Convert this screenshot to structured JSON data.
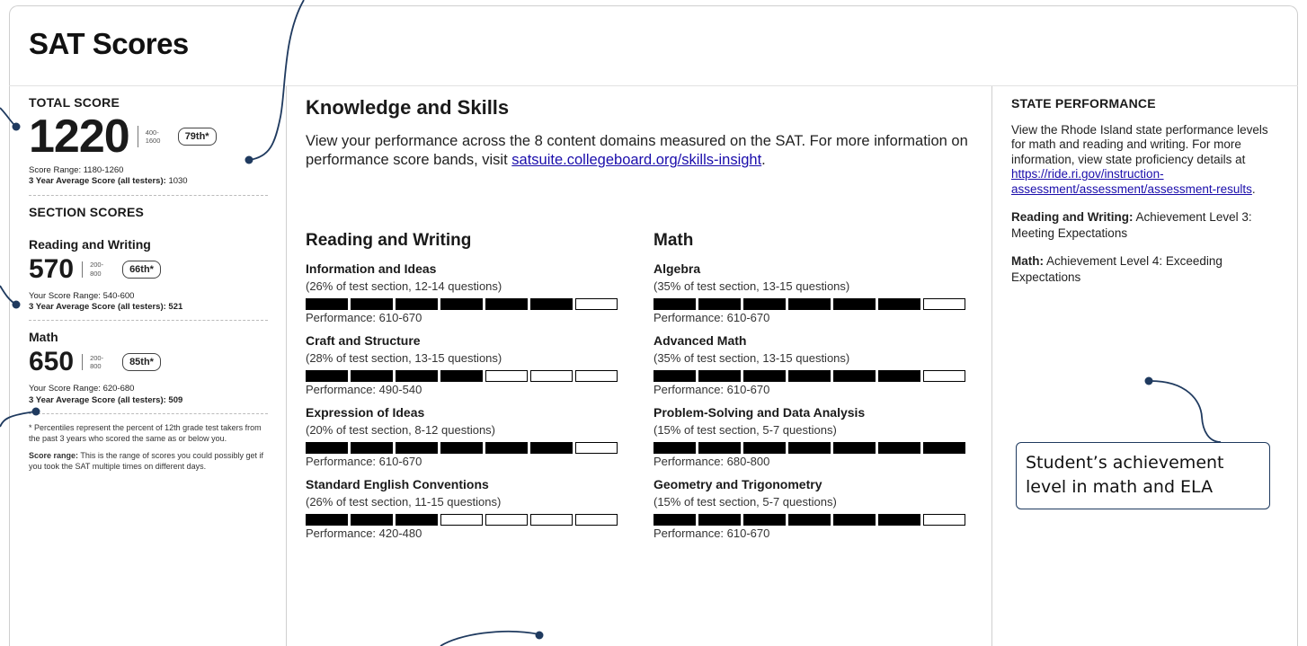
{
  "title": "SAT Scores",
  "total": {
    "label": "TOTAL SCORE",
    "score": "1220",
    "range_min": "400-",
    "range_max": "1600",
    "percentile": "79th*",
    "score_range": "Score Range: 1180-1260",
    "avg_label": "3 Year Average Score (all testers):",
    "avg_value": "1030"
  },
  "section_scores": {
    "label": "SECTION SCORES",
    "reading_writing": {
      "name": "Reading and Writing",
      "score": "570",
      "range_min": "200-",
      "range_max": "800",
      "percentile": "66th*",
      "score_range": "Your Score Range: 540-600",
      "avg": "3 Year Average Score (all testers): 521"
    },
    "math": {
      "name": "Math",
      "score": "650",
      "range_min": "200-",
      "range_max": "800",
      "percentile": "85th*",
      "score_range": "Your Score Range: 620-680",
      "avg": "3 Year Average Score (all testers): 509"
    }
  },
  "notes": {
    "percentile": "* Percentiles represent the percent of 12th grade test takers from the past 3 years who scored the same as or below you.",
    "range_label": "Score range:",
    "range_text": "This is the range of scores you could possibly get if you took the SAT multiple times on different days."
  },
  "knowledge": {
    "title": "Knowledge and Skills",
    "intro": "View your performance across the 8 content domains measured on the SAT. For more information on performance score bands, visit",
    "link": "satsuite.collegeboard.org/skills-insight",
    "period": "."
  },
  "domains": {
    "reading_writing": {
      "title": "Reading and Writing",
      "skills": [
        {
          "name": "Information and Ideas",
          "desc": "(26% of test section, 12-14 questions)",
          "filled": 6,
          "total": 7,
          "perf": "Performance: 610-670"
        },
        {
          "name": "Craft and Structure",
          "desc": "(28% of test section, 13-15 questions)",
          "filled": 4,
          "total": 7,
          "perf": "Performance: 490-540"
        },
        {
          "name": "Expression of Ideas",
          "desc": "(20% of test section, 8-12 questions)",
          "filled": 6,
          "total": 7,
          "perf": "Performance: 610-670"
        },
        {
          "name": "Standard English Conventions",
          "desc": "(26% of test section, 11-15 questions)",
          "filled": 3,
          "total": 7,
          "perf": "Performance: 420-480"
        }
      ]
    },
    "math": {
      "title": "Math",
      "skills": [
        {
          "name": "Algebra",
          "desc": "(35% of test section, 13-15 questions)",
          "filled": 6,
          "total": 7,
          "perf": "Performance: 610-670"
        },
        {
          "name": "Advanced Math",
          "desc": "(35% of test section, 13-15 questions)",
          "filled": 6,
          "total": 7,
          "perf": "Performance: 610-670"
        },
        {
          "name": "Problem-Solving and Data Analysis",
          "desc": "(15% of test section, 5-7 questions)",
          "filled": 7,
          "total": 7,
          "perf": "Performance: 680-800"
        },
        {
          "name": "Geometry and Trigonometry",
          "desc": "(15% of test section, 5-7 questions)",
          "filled": 6,
          "total": 7,
          "perf": "Performance: 610-670"
        }
      ]
    }
  },
  "state": {
    "title": "STATE PERFORMANCE",
    "desc": "View the Rhode Island state performance levels for math and reading and writing. For more information, view state proficiency details at",
    "link": "https://ride.ri.gov/instruction-assessment/assessment/assessment-results",
    "period": ".",
    "rw_label": "Reading and Writing:",
    "rw_text": "Achievement Level 3: Meeting Expectations",
    "math_label": "Math:",
    "math_text": "Achievement Level 4: Exceeding Expectations"
  },
  "callout": {
    "text": "Student’s achievement level in math and ELA"
  }
}
